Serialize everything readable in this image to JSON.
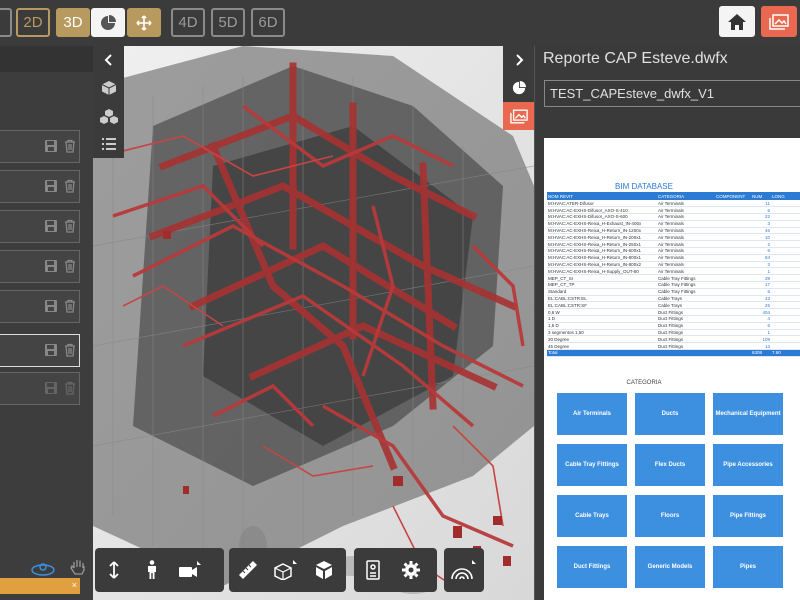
{
  "toolbar": {
    "btn_1d": "",
    "btn_2d": "2D",
    "btn_3d": "3D",
    "btn_4d": "4D",
    "btn_5d": "5D",
    "btn_6d": "6D",
    "accent_gold": "#b89a5e",
    "accent_red": "#e8694f"
  },
  "report": {
    "title": "Reporte CAP Esteve.dwfx",
    "selected": "TEST_CAPEsteve_dwfx_V1",
    "bim_title": "BIM DATABASE",
    "columns": [
      "NOM REVIT",
      "CATEGORIA",
      "COMPONENT",
      "NUM",
      "LONG"
    ],
    "rows": [
      [
        "M:HVAC:ATER-Difusor",
        "Air Terminals",
        "",
        "11",
        ""
      ],
      [
        "M:HVAC:AC-EXHS-Difusor_AXO-S-410",
        "Air Terminals",
        "",
        "6",
        ""
      ],
      [
        "M:HVAC:AC-EXHS-Difusor_AXO-S-600",
        "Air Terminals",
        "",
        "22",
        ""
      ],
      [
        "M:HVAC:AC-EXHS-Reixa_H-Exhaust_IN-400x",
        "Air Terminals",
        "",
        "3",
        ""
      ],
      [
        "M:HVAC:AC-EXHS-Reixa_H-Return_IN-1200x",
        "Air Terminals",
        "",
        "46",
        ""
      ],
      [
        "M:HVAC:AC-EXHS-Reixa_H-Return_IN-200x1",
        "Air Terminals",
        "",
        "10",
        ""
      ],
      [
        "M:HVAC:AC-EXHS-Reixa_H-Return_IN-250x1",
        "Air Terminals",
        "",
        "2",
        ""
      ],
      [
        "M:HVAC:AC-EXHS-Reixa_H-Return_IN-600x1",
        "Air Terminals",
        "",
        "6",
        ""
      ],
      [
        "M:HVAC:AC-EXHS-Reixa_H-Return_IN-800x1",
        "Air Terminals",
        "",
        "84",
        ""
      ],
      [
        "M:HVAC:AC-EXHS-Reixa_H-Return_IN-800x2",
        "Air Terminals",
        "",
        "3",
        ""
      ],
      [
        "M:HVAC:AC-EXHS-Reixa_H-Supply_OUT-80",
        "Air Terminals",
        "",
        "1",
        ""
      ],
      [
        "MEP_CT_SI",
        "Cable Tray Fittings",
        "",
        "39",
        ""
      ],
      [
        "MEP_CT_TP",
        "Cable Tray Fittings",
        "",
        "17",
        ""
      ],
      [
        "Standard",
        "Cable Tray Fittings",
        "",
        "6",
        ""
      ],
      [
        "EL:CABL:CSTR:EL",
        "Cable Trays",
        "",
        "43",
        "1"
      ],
      [
        "EL:CABL:CSTR:SF",
        "Cable Trays",
        "",
        "25",
        "1"
      ],
      [
        "0,6 W",
        "Duct Fittings",
        "",
        "404",
        ""
      ],
      [
        "1 D",
        "Duct Fittings",
        "",
        "4",
        ""
      ],
      [
        "1,5 D",
        "Duct Fittings",
        "",
        "6",
        ""
      ],
      [
        "3 segmentos 1,50",
        "Duct Fittings",
        "",
        "1",
        ""
      ],
      [
        "30 Degree",
        "Duct Fittings",
        "",
        "109",
        ""
      ],
      [
        "45 Degree",
        "Duct Fittings",
        "",
        "13",
        ""
      ]
    ],
    "total_label": "Total",
    "total_num": "6308",
    "total_long": "7.60",
    "cat_title": "CATEGORIA",
    "categories": [
      "Air Terminals",
      "Ducts",
      "Mechanical Equipment",
      "Cable Tray Fittings",
      "Flex Ducts",
      "Pipe Accessories",
      "Cable Trays",
      "Floors",
      "Pipe Fittings",
      "Duct Fittings",
      "Generic Models",
      "Pipes"
    ],
    "cat_color": "#3d8fe0"
  }
}
